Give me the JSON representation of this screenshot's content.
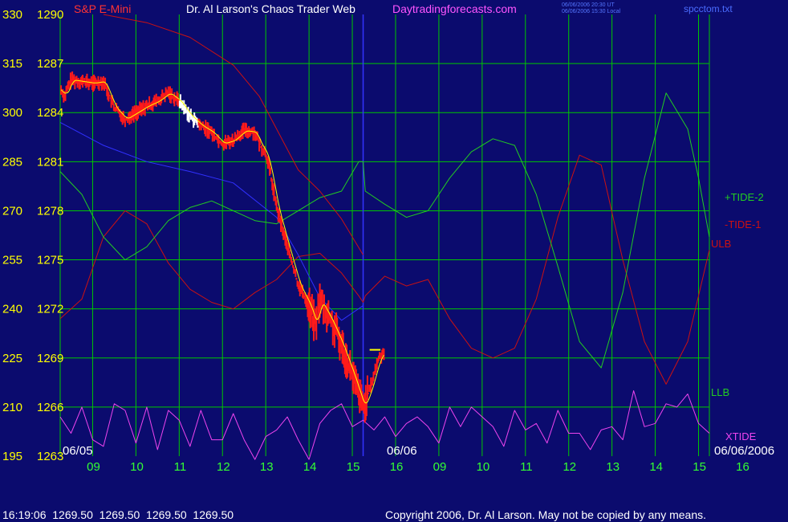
{
  "header": {
    "title_left": "S&P E-Mini",
    "title_main": "Dr. Al Larson's Chaos Trader Web",
    "site": "Daytradingforecasts.com",
    "timestamp_ut": "06/06/2006 20:30 UT",
    "timestamp_local": "06/06/2006 15:30 Local",
    "file_name": "spcctom.txt"
  },
  "footer": {
    "quote": "16:19:06  1269.50  1269.50  1269.50  1269.50",
    "copyright": "Copyright 2006, Dr. Al Larson. May not be copied by any means."
  },
  "colors": {
    "background": "#0b0b6e",
    "grid": "#00c800",
    "price_bars": "#ff1a1a",
    "price_bars_recent": "#ffffff",
    "moving_average_fast": "#ffff00",
    "moving_average_slow": "#3030ff",
    "tide_plus_2": "#22cc22",
    "tide_minus_1": "#cc1111",
    "xtide": "#ee44ee",
    "cursor": "#3333ff",
    "axis_text": "#ffff00",
    "time_labels": "#33ff33",
    "website": "#ff55ff"
  },
  "chart_data": {
    "type": "line",
    "left_axis_ticks": [
      "330",
      "315",
      "300",
      "285",
      "270",
      "255",
      "240",
      "225",
      "210",
      "195"
    ],
    "price_axis_ticks": [
      "1290",
      "1287",
      "1284",
      "1281",
      "1278",
      "1275",
      "1272",
      "1269",
      "1266",
      "1263"
    ],
    "price_range": [
      1263,
      1290
    ],
    "time_labels": [
      "09",
      "10",
      "11",
      "12",
      "13",
      "14",
      "15",
      "16",
      "09",
      "10",
      "11",
      "12",
      "13",
      "14",
      "15",
      "16"
    ],
    "date_labels": [
      "06/05",
      "06/06",
      "06/06/2006"
    ],
    "last_price": 1269.5,
    "series": [
      {
        "name": "S&P E-Mini",
        "x": [
          0,
          0.1,
          0.25,
          0.5,
          0.75,
          1.0,
          1.25,
          1.5,
          1.75,
          2.0,
          2.25,
          2.5,
          2.75,
          3.0,
          3.25,
          3.5,
          3.75,
          4.0,
          4.25,
          4.5,
          4.6,
          4.75,
          4.85,
          5.0,
          5.25,
          5.5,
          5.75,
          5.9,
          6.0,
          6.25,
          6.4,
          6.5,
          6.75,
          6.9,
          7.0,
          7.15,
          7.35,
          7.5
        ],
        "values": [
          1285.5,
          1285.0,
          1286.0,
          1285.9,
          1285.8,
          1285.9,
          1284.3,
          1283.6,
          1284.0,
          1284.4,
          1284.7,
          1285.2,
          1284.7,
          1283.8,
          1283.2,
          1282.8,
          1282.1,
          1282.3,
          1282.9,
          1282.8,
          1282.1,
          1281.5,
          1280.4,
          1278.2,
          1275.8,
          1273.5,
          1272.2,
          1271.0,
          1272.5,
          1271.3,
          1270.4,
          1269.8,
          1268.0,
          1266.8,
          1266.0,
          1267.0,
          1268.9,
          1269.5
        ]
      },
      {
        "name": "+TIDE-2",
        "x": [
          0,
          0.5,
          1.0,
          1.5,
          2.0,
          2.5,
          3.0,
          3.5,
          4.0,
          4.5,
          5.0,
          5.5,
          6.0,
          6.5,
          6.9,
          7.0,
          7.05,
          7.5,
          8.0,
          8.5,
          9.0,
          9.5,
          10.0,
          10.5,
          11.0,
          11.5,
          12.0,
          12.5,
          13.0,
          13.5,
          14.0,
          14.5,
          14.75,
          15.0
        ],
        "values": [
          282,
          275,
          262,
          255,
          259,
          267,
          271,
          273,
          270,
          267,
          266,
          270,
          274,
          276,
          285,
          285,
          276,
          272,
          268,
          270,
          280,
          288,
          292,
          290,
          275,
          253,
          230,
          222,
          245,
          280,
          306,
          295,
          280,
          262
        ]
      },
      {
        "name": "-TIDE-1",
        "x": [
          0,
          0.5,
          1.0,
          1.5,
          2.0,
          2.5,
          3.0,
          3.5,
          4.0,
          4.5,
          5.0,
          5.5,
          6.0,
          6.5,
          6.9,
          7.0,
          7.05,
          7.5,
          8.0,
          8.5,
          9.0,
          9.5,
          10.0,
          10.5,
          11.0,
          11.5,
          12.0,
          12.5,
          13.0,
          13.5,
          14.0,
          14.5,
          15.0
        ],
        "values": [
          237,
          243,
          262,
          270,
          266,
          254,
          246,
          242,
          240,
          245,
          249,
          256,
          257,
          251,
          244,
          242,
          244,
          250,
          247,
          249,
          237,
          228,
          225,
          228,
          243,
          268,
          287,
          284,
          255,
          230,
          217,
          230,
          258
        ]
      },
      {
        "name": "XTIDE",
        "x": [
          0,
          0.25,
          0.5,
          0.75,
          1.0,
          1.25,
          1.5,
          1.75,
          2.0,
          2.25,
          2.5,
          2.75,
          3.0,
          3.25,
          3.5,
          3.75,
          4.0,
          4.25,
          4.5,
          4.75,
          5.0,
          5.25,
          5.5,
          5.75,
          6.0,
          6.25,
          6.5,
          6.75,
          7.0,
          7.25,
          7.5,
          7.75,
          8.0,
          8.25,
          8.5,
          8.75,
          9.0,
          9.25,
          9.5,
          9.75,
          10.0,
          10.25,
          10.5,
          10.75,
          11.0,
          11.25,
          11.5,
          11.75,
          12.0,
          12.25,
          12.5,
          12.75,
          13.0,
          13.25,
          13.5,
          13.75,
          14.0,
          14.25,
          14.5,
          14.75,
          15.0
        ],
        "values": [
          207,
          202,
          210,
          200,
          198,
          211,
          209,
          199,
          210,
          197,
          209,
          206,
          198,
          209,
          200,
          200,
          208,
          200,
          194,
          201,
          203,
          207,
          200,
          194,
          205,
          209,
          211,
          204,
          206,
          203,
          207,
          201,
          205,
          207,
          204,
          199,
          210,
          204,
          210,
          207,
          204,
          198,
          209,
          203,
          205,
          199,
          209,
          202,
          202,
          197,
          203,
          204,
          200,
          215,
          204,
          205,
          211,
          210,
          214,
          205,
          202
        ]
      },
      {
        "name": "ULB",
        "x": [
          1.0,
          2.0,
          3.0,
          4.0,
          4.6,
          5.0,
          5.5,
          6.0,
          6.5,
          7.0
        ],
        "values": [
          1290.0,
          1289.5,
          1288.6,
          1286.9,
          1285.0,
          1283.0,
          1280.5,
          1279.2,
          1277.5,
          1275.3
        ]
      },
      {
        "name": "LLB",
        "x": [
          0,
          1.0,
          2.0,
          3.0,
          4.0,
          5.0,
          5.5,
          6.0,
          6.5,
          7.0
        ],
        "values": [
          1283.4,
          1282.0,
          1281.0,
          1280.4,
          1279.7,
          1277.6,
          1275.3,
          1272.7,
          1271.3,
          1272.2
        ]
      }
    ]
  },
  "legend": {
    "plus_tide": "+TIDE-2",
    "minus_tide": "-TIDE-1",
    "ulb": "ULB",
    "llb": "LLB",
    "xtide": "XTIDE"
  }
}
